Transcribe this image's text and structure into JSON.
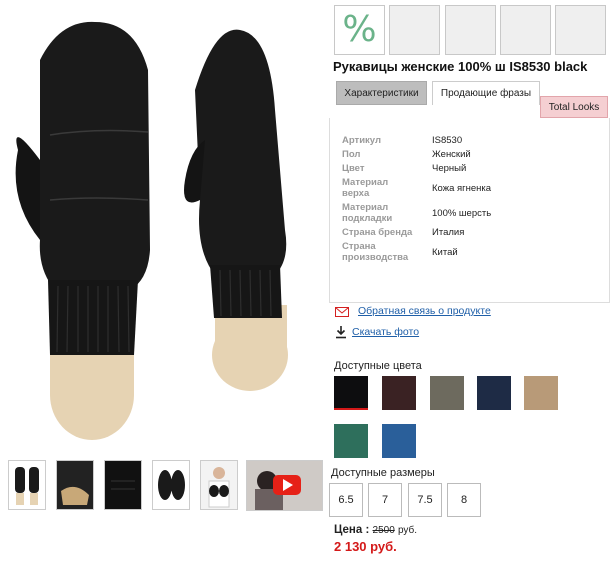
{
  "product": {
    "title": "Рукавицы женские 100% ш IS8530 black",
    "discount_icon": "%"
  },
  "tabs": [
    "Характеристики",
    "Продающие фразы",
    "Total Looks"
  ],
  "specs": [
    {
      "key": "Артикул",
      "value": "IS8530"
    },
    {
      "key": "Пол",
      "value": "Женский"
    },
    {
      "key": "Цвет",
      "value": "Черный"
    },
    {
      "key": "Материал верха",
      "value": "Кожа ягненка"
    },
    {
      "key": "Материал подкладки",
      "value": "100% шерсть"
    },
    {
      "key": "Страна бренда",
      "value": "Италия"
    },
    {
      "key": "Страна производства",
      "value": "Китай"
    }
  ],
  "links": {
    "feedback": "Обратная связь о продукте",
    "download": "Скачать фото"
  },
  "colors_label": "Доступные цвета",
  "colors": [
    "#0d0d0f",
    "#3a2223",
    "#6d6a5e",
    "#1e2b45",
    "#b89a78",
    "#2e6f5c",
    "#2a5f9a"
  ],
  "sizes_label": "Доступные размеры",
  "sizes": [
    "6.5",
    "7",
    "7.5",
    "8"
  ],
  "price": {
    "label": "Цена :",
    "old": "2500",
    "currency": "руб.",
    "new": "2 130 руб."
  }
}
